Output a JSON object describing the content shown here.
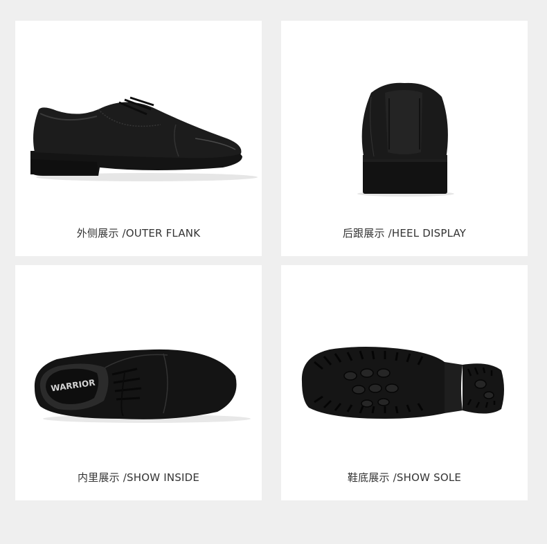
{
  "panels": [
    {
      "caption": "外侧展示 /OUTER FLANK"
    },
    {
      "caption": "后跟展示 /HEEL DISPLAY"
    },
    {
      "caption": "内里展示 /SHOW INSIDE",
      "insole_brand": "WARRIOR"
    },
    {
      "caption": "鞋底展示 /SHOW SOLE"
    }
  ]
}
